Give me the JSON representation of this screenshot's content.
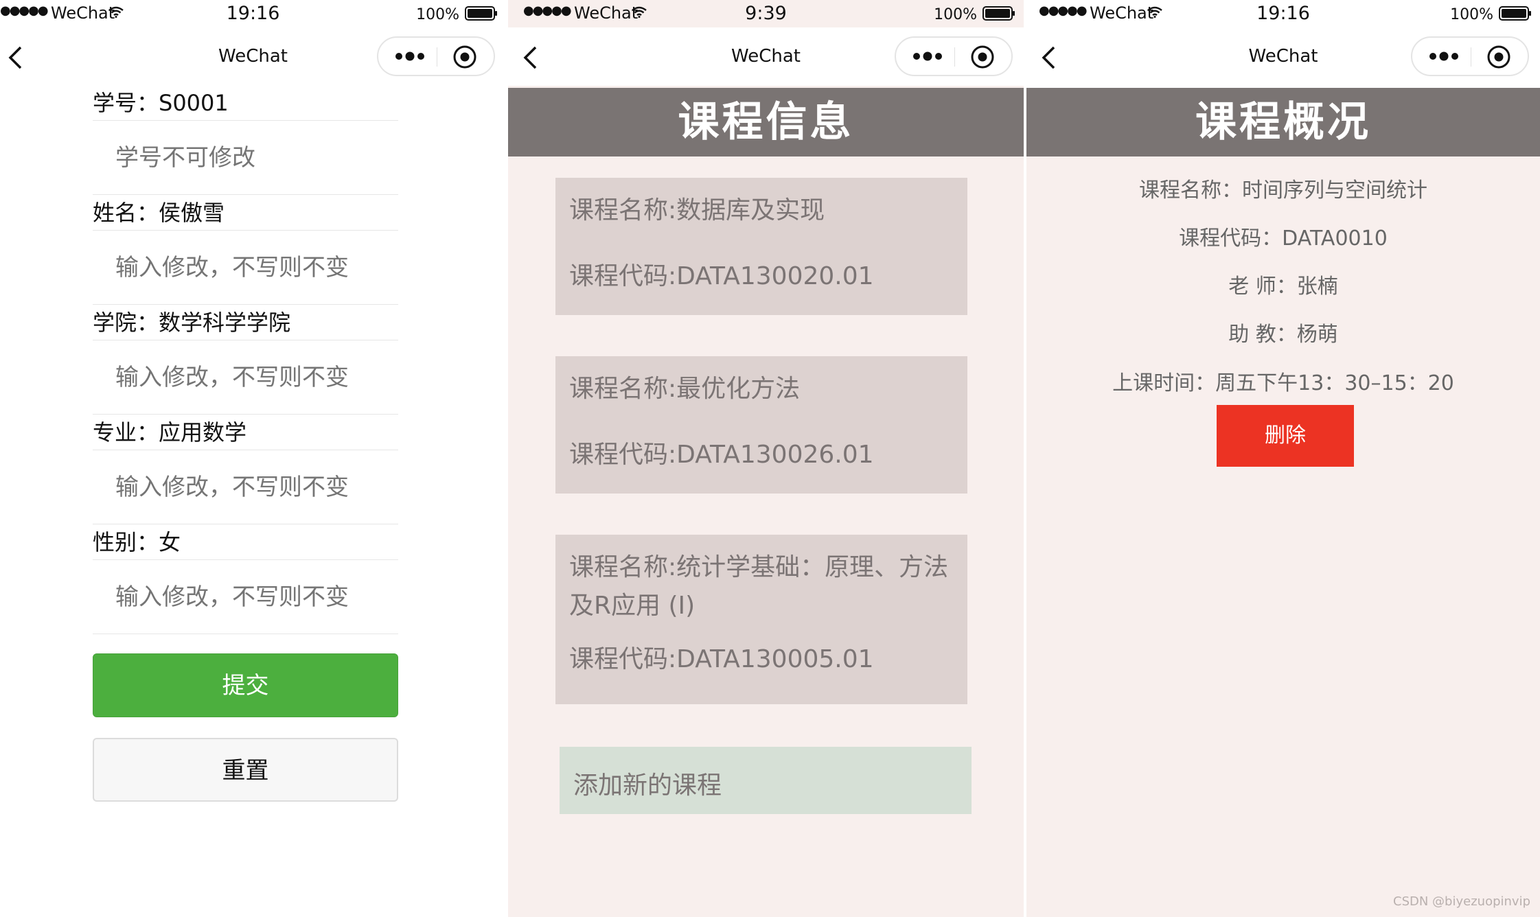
{
  "panel1": {
    "status": {
      "carrier": "WeChat",
      "time": "19:16",
      "battery": "100%"
    },
    "nav": {
      "title": "WeChat"
    },
    "fields": [
      {
        "label": "学号：S0001",
        "placeholder": "学号不可修改"
      },
      {
        "label": "姓名：侯傲雪",
        "placeholder": "输入修改，不写则不变"
      },
      {
        "label": "学院：数学科学学院",
        "placeholder": "输入修改，不写则不变"
      },
      {
        "label": "专业：应用数学",
        "placeholder": "输入修改，不写则不变"
      },
      {
        "label": "性别：女",
        "placeholder": "输入修改，不写则不变"
      }
    ],
    "submit_label": "提交",
    "reset_label": "重置"
  },
  "panel2": {
    "status": {
      "carrier": "WeChat",
      "time": "9:39",
      "battery": "100%"
    },
    "nav": {
      "title": "WeChat"
    },
    "header": "课程信息",
    "courses": [
      {
        "name": "课程名称:数据库及实现",
        "code": "课程代码:DATA130020.01"
      },
      {
        "name": "课程名称:最优化方法",
        "code": "课程代码:DATA130026.01"
      },
      {
        "name": "课程名称:统计学基础：原理、方法及R应用 (I)",
        "code": "课程代码:DATA130005.01"
      }
    ],
    "add_label": "添加新的课程"
  },
  "panel3": {
    "status": {
      "carrier": "WeChat",
      "time": "19:16",
      "battery": "100%"
    },
    "nav": {
      "title": "WeChat"
    },
    "header": "课程概况",
    "lines": [
      "课程名称：时间序列与空间统计",
      "课程代码：DATA0010",
      "老 师：张楠",
      "助 教：杨萌",
      "上课时间：周五下午13：30–15：20"
    ],
    "delete_label": "删除"
  },
  "watermark": "CSDN @biyezuopinvip",
  "colors": {
    "submit": "#4caf3e",
    "delete": "#ec3323",
    "header_band": "#7a7473",
    "card": "#ddd2d0",
    "add_card": "#d6e0d6",
    "panel_bg": "#f8efed"
  }
}
